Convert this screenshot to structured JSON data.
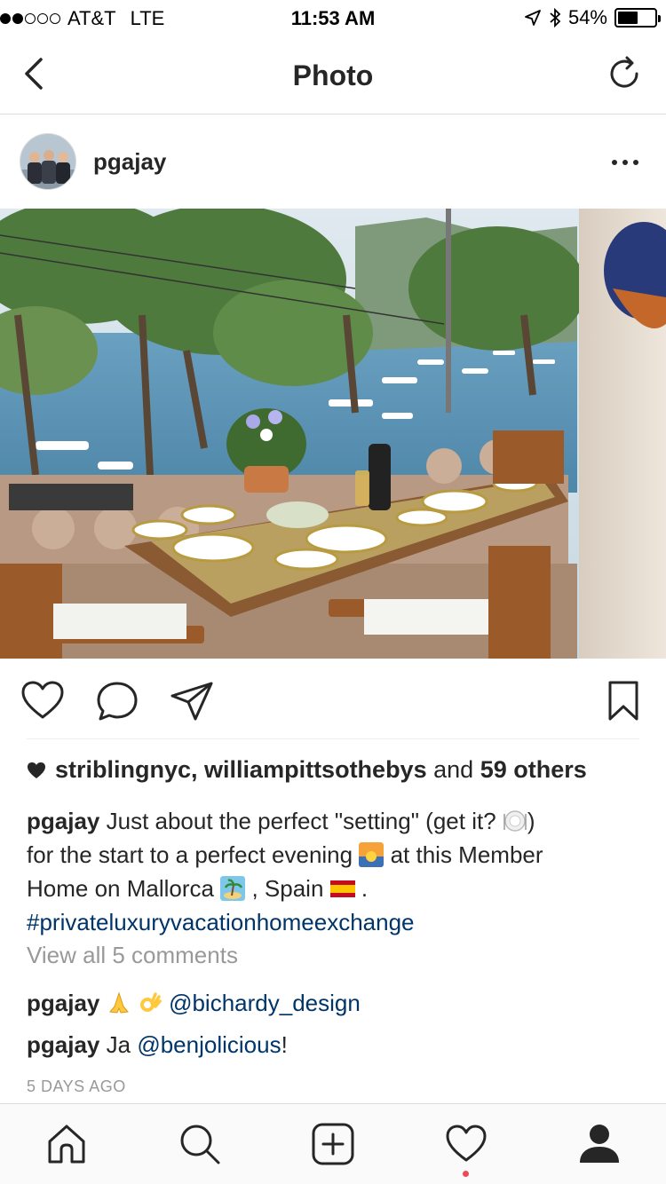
{
  "status": {
    "carrier": "AT&T",
    "network": "LTE",
    "time": "11:53 AM",
    "battery": "54%",
    "battery_level": 0.54
  },
  "nav": {
    "title": "Photo"
  },
  "post": {
    "username": "pgajay",
    "likes": {
      "user1": "striblingnyc,",
      "user2": "williampittsothebys",
      "and_text": "and",
      "others": "59 others"
    },
    "caption": {
      "username": "pgajay",
      "text1": "Just about the perfect \"setting\" (get it?",
      "text2": ")",
      "text3": "for the start  to a perfect evening",
      "text4": "at this Member",
      "text5": "Home on Mallorca",
      "text6": ", Spain",
      "text7": ".",
      "hashtag": "#privateluxuryvacationhomeexchange"
    },
    "view_all": "View all 5 comments",
    "comments": [
      {
        "username": "pgajay",
        "mention": "@bichardy_design"
      },
      {
        "username": "pgajay",
        "text": "Ja",
        "mention": "@benjolicious",
        "suffix": "!"
      }
    ],
    "timestamp": "5 DAYS AGO"
  },
  "icons": {
    "back": "chevron-left-icon",
    "refresh": "refresh-icon",
    "more": "more-dots-icon",
    "like": "heart-icon",
    "comment": "comment-bubble-icon",
    "share": "paper-plane-icon",
    "save": "bookmark-icon",
    "home": "home-icon",
    "search": "search-icon",
    "add": "add-post-icon",
    "activity": "heart-outline-icon",
    "profile": "profile-icon"
  },
  "colors": {
    "link": "#003569",
    "text": "#262626",
    "muted": "#999999",
    "notification": "#ed4956"
  }
}
